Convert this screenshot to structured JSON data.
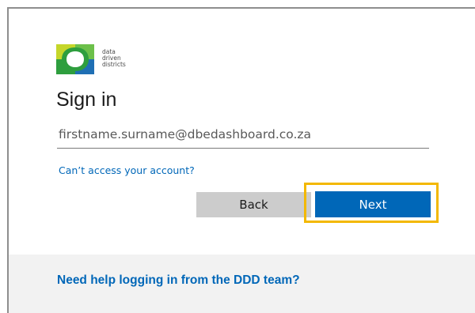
{
  "brand": {
    "logo_lines": [
      "data",
      "driven",
      "districts"
    ],
    "colors": {
      "green": "#2e9e3e",
      "lime": "#c5d62a",
      "blue": "#1f6fb4",
      "yellow": "#f3b800"
    }
  },
  "signin": {
    "title": "Sign in",
    "email_value": "firstname.surname@dbedashboard.co.za",
    "cant_access_label": "Can’t access your account?",
    "back_label": "Back",
    "next_label": "Next",
    "accent_color": "#0067b8",
    "highlight_color": "#f3b800"
  },
  "footer": {
    "help_label": "Need help logging in from the DDD team?"
  }
}
